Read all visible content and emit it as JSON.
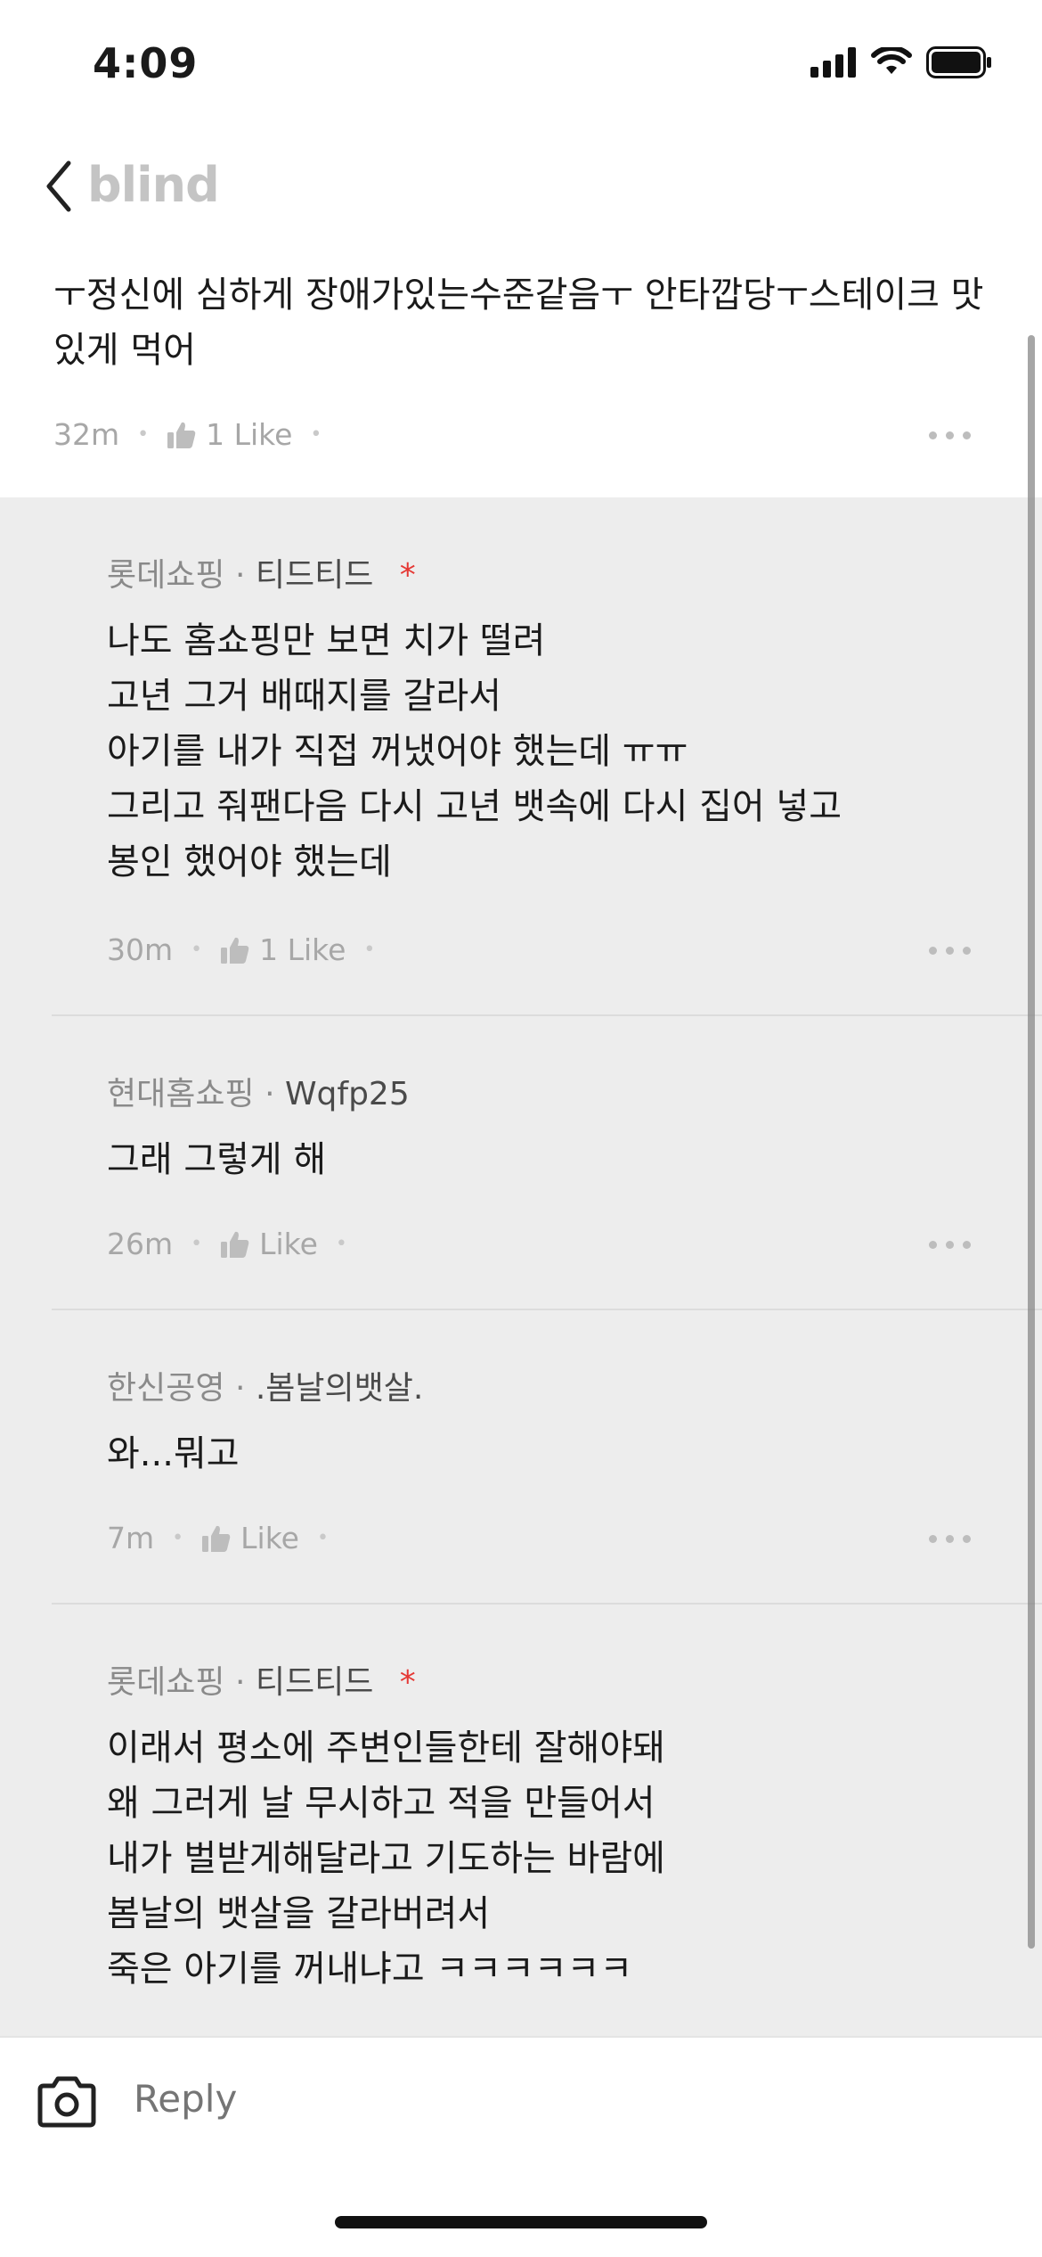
{
  "status_bar": {
    "time": "4:09"
  },
  "nav": {
    "brand": "blind"
  },
  "post": {
    "text": "ㅜ정신에 심하게 장애가있는수준같음ㅜ 안타깝당ㅜ스테이크 맛있게 먹어",
    "time": "32m",
    "like_label": "1 Like"
  },
  "comments": [
    {
      "company": "롯데쇼핑",
      "nickname": "티드티드",
      "author_marker": "*",
      "text": "나도 홈쇼핑만 보면 치가 떨려\n고년 그거 배때지를 갈라서\n아기를 내가 직접 꺼냈어야 했는데 ㅠㅠ\n그리고 줘팬다음 다시 고년 뱃속에 다시 집어 넣고\n봉인 했어야 했는데",
      "time": "30m",
      "like_label": "1 Like"
    },
    {
      "company": "현대홈쇼핑",
      "nickname": "Wqfp25",
      "author_marker": "",
      "text": "그래 그렇게 해",
      "time": "26m",
      "like_label": "Like"
    },
    {
      "company": "한신공영",
      "nickname": ".봄날의뱃살.",
      "author_marker": "",
      "text": "와...뭐고",
      "time": "7m",
      "like_label": "Like"
    },
    {
      "company": "롯데쇼핑",
      "nickname": "티드티드",
      "author_marker": "*",
      "text": "이래서 평소에 주변인들한테 잘해야돼\n왜 그러게 날 무시하고 적을 만들어서\n내가 벌받게해달라고 기도하는 바람에\n봄날의 뱃살을 갈라버려서\n죽은 아기를 꺼내냐고 ㅋㅋㅋㅋㅋㅋ",
      "time": "",
      "like_label": ""
    }
  ],
  "reply": {
    "placeholder": "Reply"
  },
  "colors": {
    "author_marker": "#e53935",
    "thread_background": "#ededed",
    "brand_gray": "#c4c4c4"
  },
  "icons": [
    "back-chevron-icon",
    "thumbs-up-icon",
    "more-icon",
    "camera-icon",
    "signal-icon",
    "wifi-icon",
    "battery-icon"
  ]
}
